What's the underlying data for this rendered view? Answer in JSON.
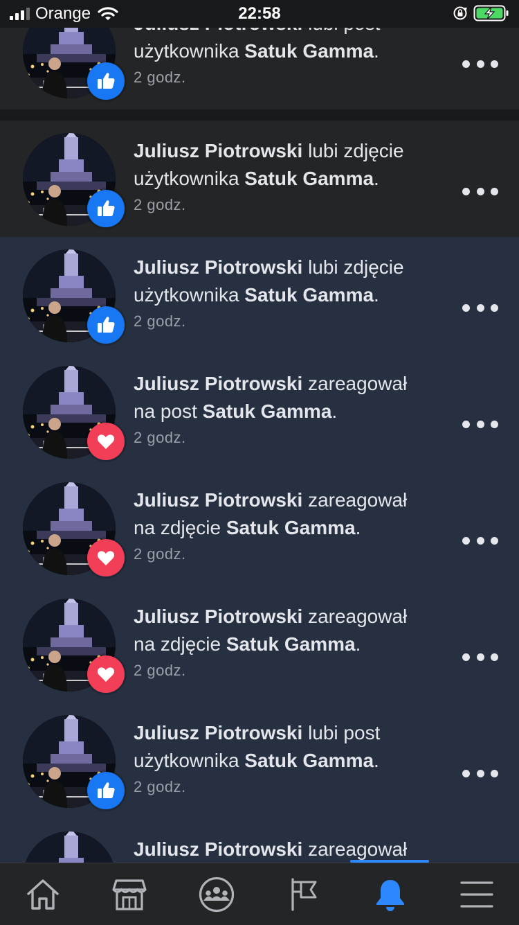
{
  "status_bar": {
    "carrier": "Orange",
    "time": "22:58"
  },
  "notifications": [
    {
      "actor": "Juliusz Piotrowski",
      "l1_rest": "lubi post",
      "l2_pre": "użytkownika",
      "target": "Satuk Gamma",
      "l2_post": ".",
      "time": "2 godz.",
      "reaction": "like",
      "state": "read"
    },
    {
      "actor": "Juliusz Piotrowski",
      "l1_rest": "lubi zdjęcie",
      "l2_pre": "użytkownika",
      "target": "Satuk Gamma",
      "l2_post": ".",
      "time": "2 godz.",
      "reaction": "like",
      "state": "read"
    },
    {
      "actor": "Juliusz Piotrowski",
      "l1_rest": "lubi zdjęcie",
      "l2_pre": "użytkownika",
      "target": "Satuk Gamma",
      "l2_post": ".",
      "time": "2 godz.",
      "reaction": "like",
      "state": "unread"
    },
    {
      "actor": "Juliusz Piotrowski",
      "l1_rest": "zareagował",
      "l2_pre": "na post",
      "target": "Satuk Gamma",
      "l2_post": ".",
      "time": "2 godz.",
      "reaction": "love",
      "state": "unread"
    },
    {
      "actor": "Juliusz Piotrowski",
      "l1_rest": "zareagował",
      "l2_pre": "na zdjęcie",
      "target": "Satuk Gamma",
      "l2_post": ".",
      "time": "2 godz.",
      "reaction": "love",
      "state": "unread"
    },
    {
      "actor": "Juliusz Piotrowski",
      "l1_rest": "zareagował",
      "l2_pre": "na zdjęcie",
      "target": "Satuk Gamma",
      "l2_post": ".",
      "time": "2 godz.",
      "reaction": "love",
      "state": "unread"
    },
    {
      "actor": "Juliusz Piotrowski",
      "l1_rest": "lubi post",
      "l2_pre": "użytkownika",
      "target": "Satuk Gamma",
      "l2_post": ".",
      "time": "2 godz.",
      "reaction": "like",
      "state": "unread"
    },
    {
      "actor": "Juliusz Piotrowski",
      "l1_rest": "zareagował",
      "l2_pre": "",
      "target": "",
      "l2_post": "",
      "time": "",
      "reaction": "none",
      "state": "unread"
    }
  ],
  "bottom_nav": [
    {
      "id": "home",
      "icon": "home-icon",
      "active": false
    },
    {
      "id": "marketplace",
      "icon": "marketplace-icon",
      "active": false
    },
    {
      "id": "groups",
      "icon": "groups-icon",
      "active": false
    },
    {
      "id": "pages",
      "icon": "flag-icon",
      "active": false
    },
    {
      "id": "notifications",
      "icon": "bell-icon",
      "active": true
    },
    {
      "id": "menu",
      "icon": "menu-icon",
      "active": false
    }
  ],
  "colors": {
    "accent": "#2d88ff",
    "like": "#1877f2",
    "love": "#f33e58",
    "unread_bg": "#263041",
    "read_bg": "#242526"
  }
}
